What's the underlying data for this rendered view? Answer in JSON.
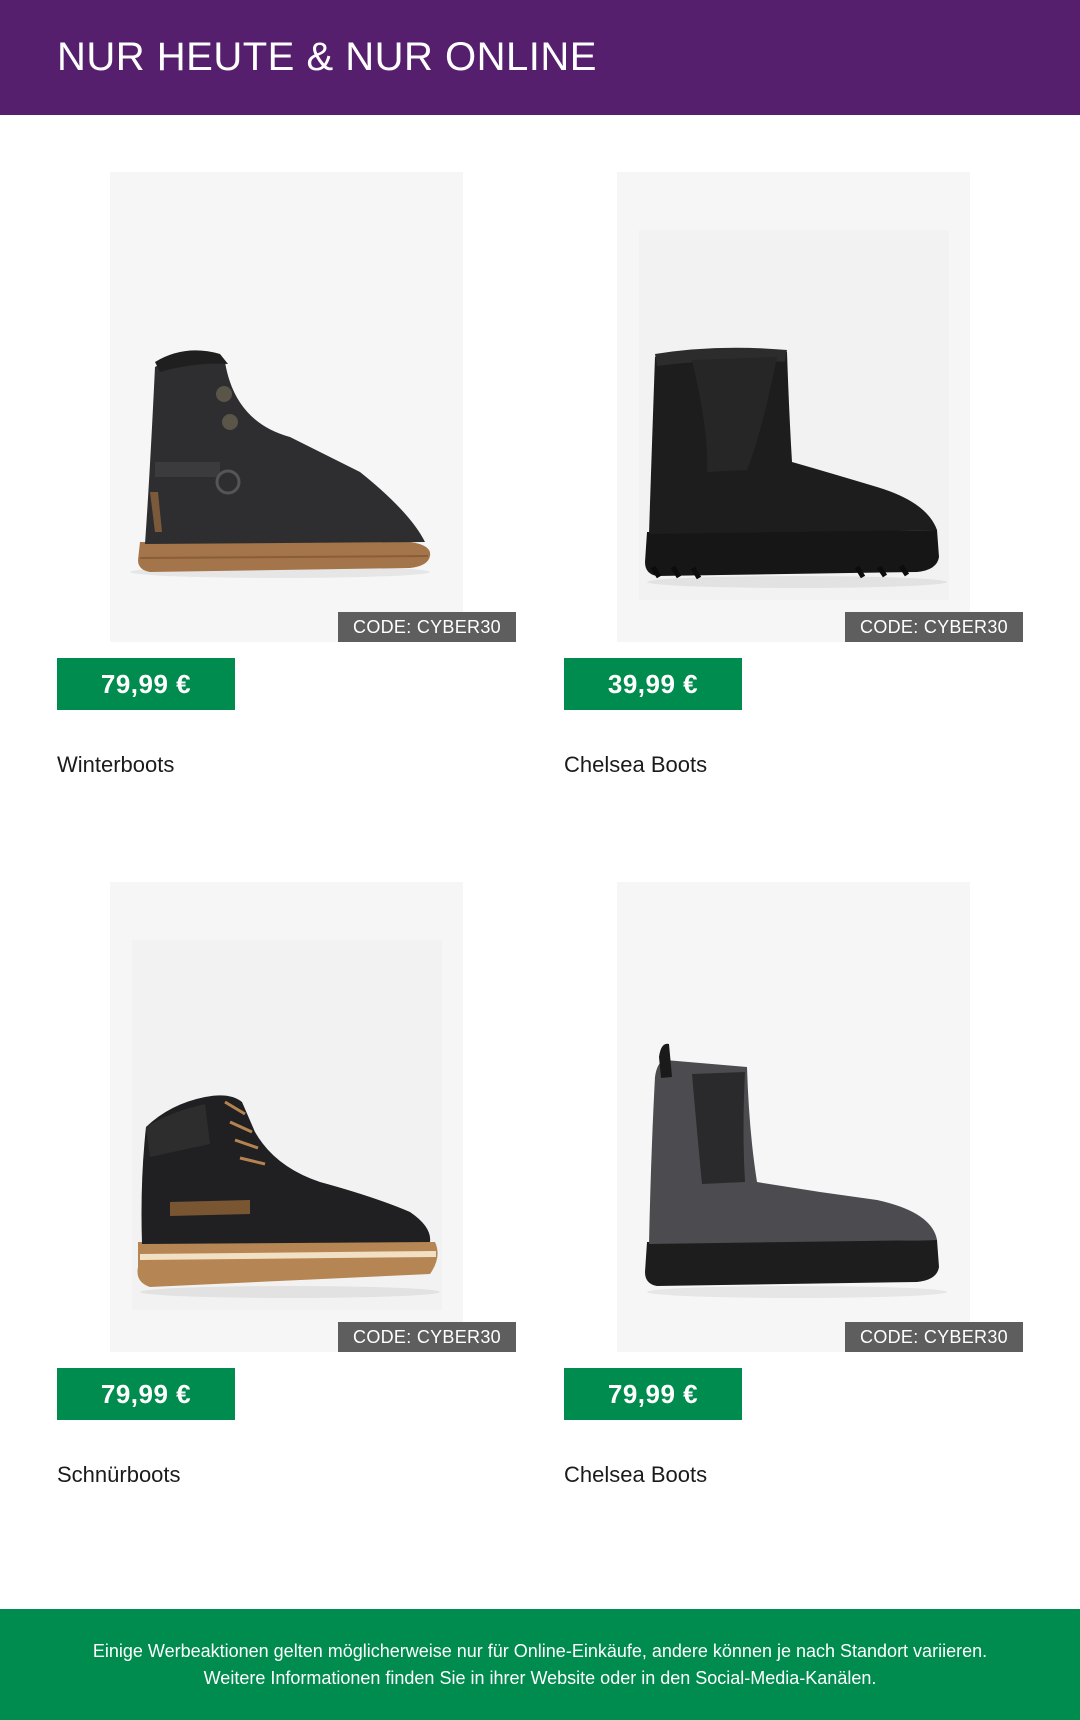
{
  "header": {
    "title": "NUR HEUTE & NUR ONLINE"
  },
  "products": [
    {
      "name": "Winterboots",
      "price": "79,99 €",
      "code": "CODE: CYBER30",
      "image": "winter-boot-fur-image"
    },
    {
      "name": "Chelsea Boots",
      "price": "39,99 €",
      "code": "CODE: CYBER30",
      "image": "black-chelsea-boot-image"
    },
    {
      "name": "Schnürboots",
      "price": "79,99 €",
      "code": "CODE: CYBER30",
      "image": "lace-up-boot-image"
    },
    {
      "name": "Chelsea Boots",
      "price": "79,99 €",
      "code": "CODE: CYBER30",
      "image": "grey-chelsea-boot-image"
    }
  ],
  "footer": {
    "text": "Einige Werbeaktionen gelten möglicherweise nur für Online-Einkäufe, andere können je nach Standort variieren. Weitere Informationen finden Sie in ihrer Website oder in den Social-Media-Kanälen."
  },
  "colors": {
    "header_bg": "#561f6e",
    "price_bg": "#008c4e",
    "code_bg": "#5e5e5e",
    "footer_bg": "#008c4e"
  }
}
